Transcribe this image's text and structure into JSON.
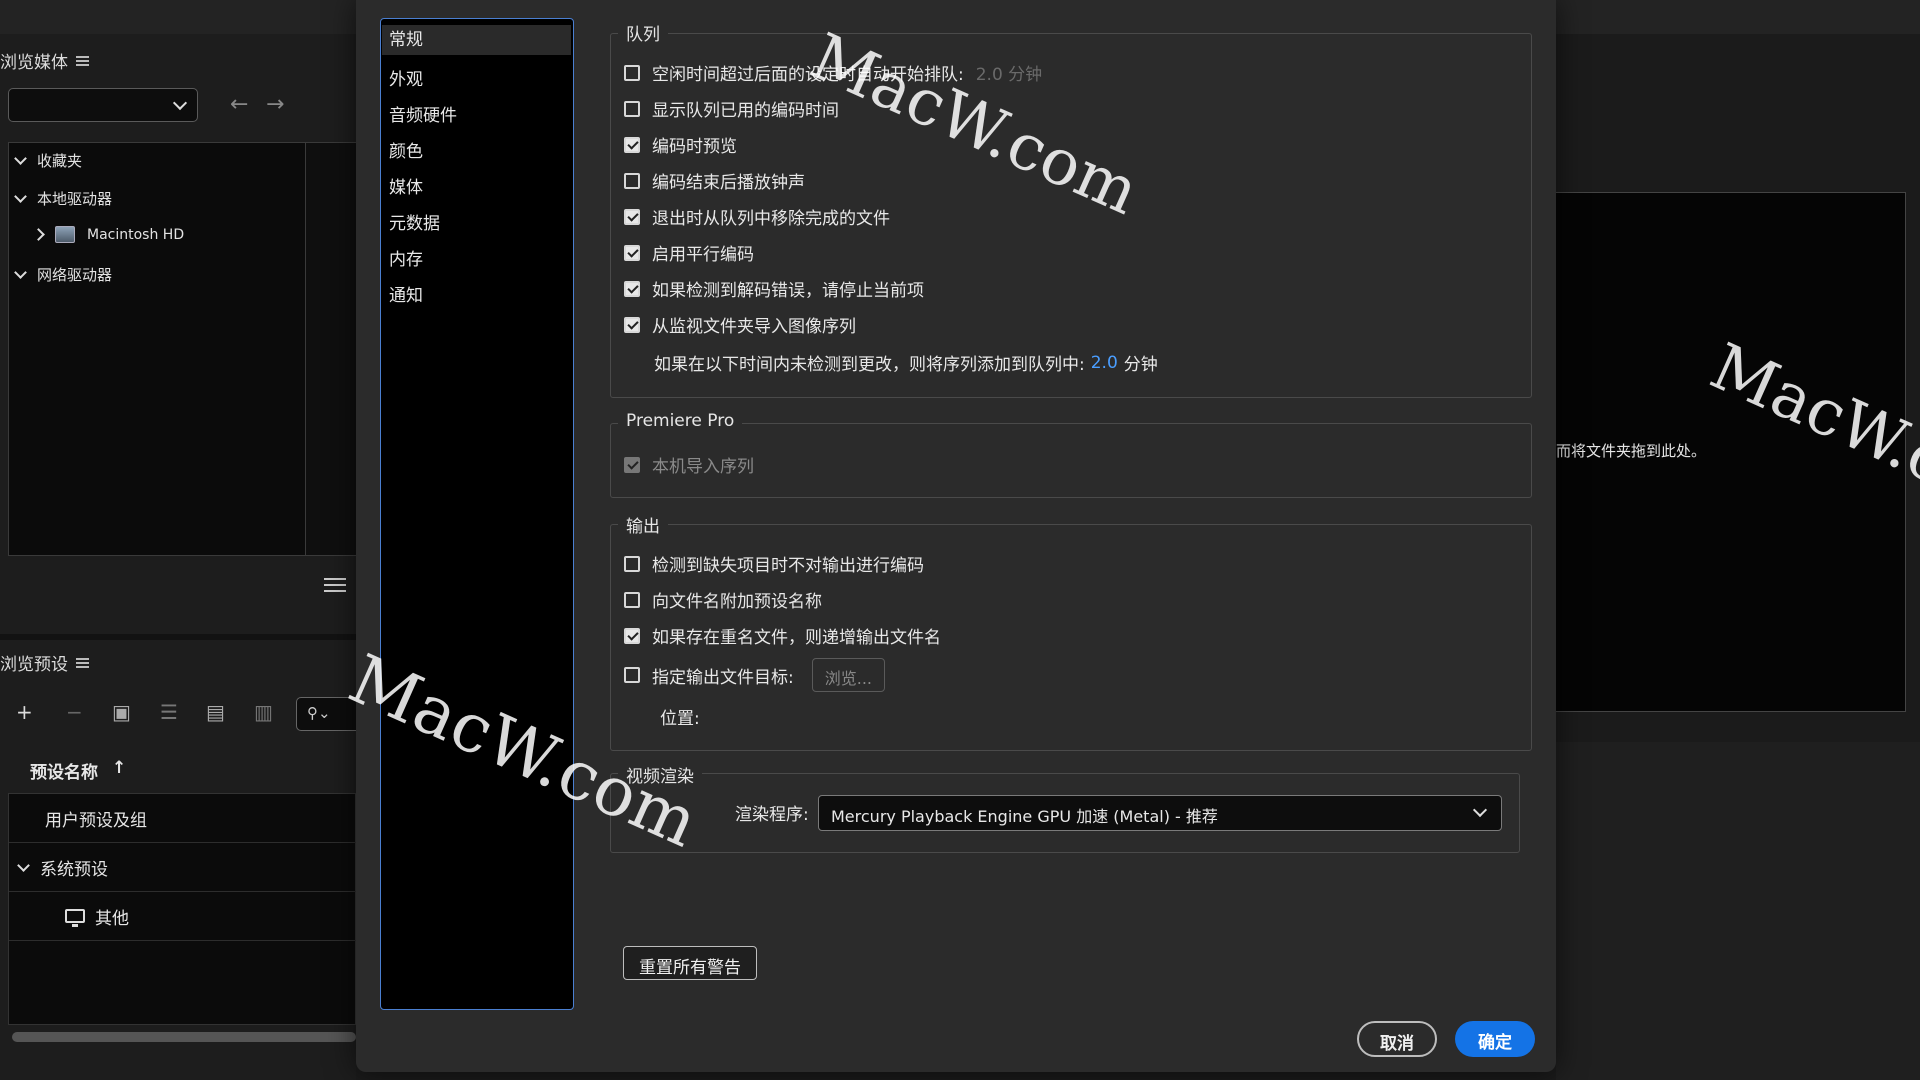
{
  "browse_media": {
    "title": "浏览媒体",
    "tree": [
      {
        "label": "收藏夹",
        "state": "expanded"
      },
      {
        "label": "本地驱动器",
        "state": "expanded"
      },
      {
        "label": "Macintosh HD",
        "state": "collapsed"
      },
      {
        "label": "网络驱动器",
        "state": "expanded"
      }
    ]
  },
  "browse_presets": {
    "title": "浏览预设",
    "column_header": "预设名称",
    "rows": [
      {
        "label": "用户预设及组"
      },
      {
        "label": "系统预设"
      },
      {
        "label": "其他"
      }
    ]
  },
  "right_panel": {
    "drop_hint": "而将文件夹拖到此处。"
  },
  "preferences": {
    "nav": [
      "常规",
      "外观",
      "音频硬件",
      "颜色",
      "媒体",
      "元数据",
      "内存",
      "通知"
    ],
    "queue": {
      "title": "队列",
      "items": [
        {
          "label": "空闲时间超过后面的设定时自动开始排队:",
          "checked": false,
          "suffix": "2.0 分钟"
        },
        {
          "label": "显示队列已用的编码时间",
          "checked": false
        },
        {
          "label": "编码时预览",
          "checked": true
        },
        {
          "label": "编码结束后播放钟声",
          "checked": false
        },
        {
          "label": "退出时从队列中移除完成的文件",
          "checked": true
        },
        {
          "label": "启用平行编码",
          "checked": true
        },
        {
          "label": "如果检测到解码错误，请停止当前项",
          "checked": true
        },
        {
          "label": "从监视文件夹导入图像序列",
          "checked": true
        }
      ],
      "watch_text": "如果在以下时间内未检测到更改，则将序列添加到队列中:",
      "watch_value": "2.0",
      "watch_unit": "分钟"
    },
    "premiere": {
      "title": "Premiere Pro",
      "item": {
        "label": "本机导入序列",
        "checked": true,
        "disabled": true
      }
    },
    "output": {
      "title": "输出",
      "items": [
        {
          "label": "检测到缺失项目时不对输出进行编码",
          "checked": false
        },
        {
          "label": "向文件名附加预设名称",
          "checked": false
        },
        {
          "label": "如果存在重名文件，则递增输出文件名",
          "checked": true
        },
        {
          "label": "指定输出文件目标:",
          "checked": false
        }
      ],
      "browse_label": "浏览...",
      "location_label": "位置:"
    },
    "video_render": {
      "title": "视频渲染",
      "renderer_label": "渲染程序:",
      "renderer_value": "Mercury Playback Engine GPU 加速 (Metal) - 推荐"
    },
    "reset_warnings": "重置所有警告",
    "cancel": "取消",
    "ok": "确定"
  },
  "watermark": "MacW.com",
  "colors": {
    "accent": "#1473e6",
    "focus": "#4a7fd1",
    "value_link": "#4a9eff"
  }
}
